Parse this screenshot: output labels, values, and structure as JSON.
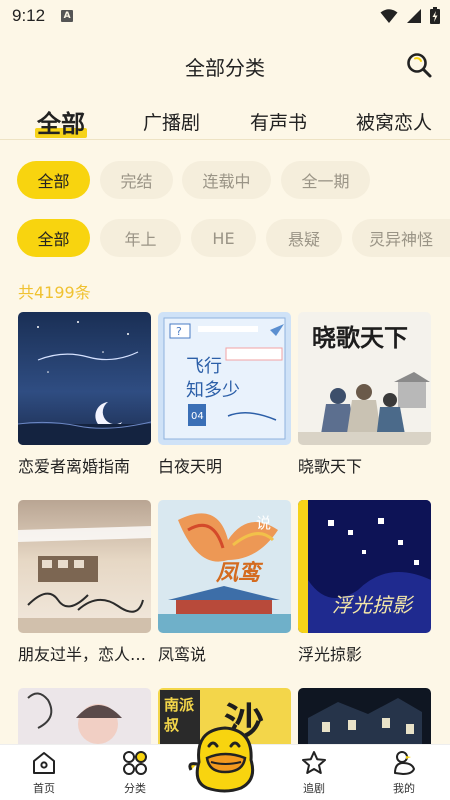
{
  "status": {
    "time": "9:12",
    "notification_glyph": "A"
  },
  "header": {
    "title": "全部分类",
    "search_icon": "search-icon"
  },
  "tabs": [
    {
      "label": "全部",
      "active": true
    },
    {
      "label": "广播剧",
      "active": false
    },
    {
      "label": "有声书",
      "active": false
    },
    {
      "label": "被窝恋人",
      "active": false
    }
  ],
  "filter_status": [
    {
      "label": "全部",
      "active": true
    },
    {
      "label": "完结",
      "active": false
    },
    {
      "label": "连载中",
      "active": false
    },
    {
      "label": "全一期",
      "active": false
    }
  ],
  "filter_genre": [
    {
      "label": "全部",
      "active": true
    },
    {
      "label": "年上",
      "active": false
    },
    {
      "label": "HE",
      "active": false
    },
    {
      "label": "悬疑",
      "active": false
    },
    {
      "label": "灵异神怪",
      "active": false
    }
  ],
  "result_count": "共4199条",
  "books": [
    {
      "title": "恋爱者离婚指南",
      "cover_text": ""
    },
    {
      "title": "白夜天明",
      "cover_text": "飞行知多少"
    },
    {
      "title": "晓歌天下",
      "cover_text": "晓歌天下"
    },
    {
      "title": "朋友过半，恋人未满",
      "cover_text": ""
    },
    {
      "title": "凤鸾说",
      "cover_text": "凤鸾说"
    },
    {
      "title": "浮光掠影",
      "cover_text": "浮光掠影"
    },
    {
      "title": "",
      "cover_text": ""
    },
    {
      "title": "",
      "cover_text": "南派叔"
    },
    {
      "title": "",
      "cover_text": ""
    }
  ],
  "bottom_nav": [
    {
      "label": "首页",
      "icon": "home-icon"
    },
    {
      "label": "分类",
      "icon": "category-icon"
    },
    {
      "label": "追剧",
      "icon": "star-icon"
    },
    {
      "label": "我的",
      "icon": "profile-duck-icon"
    }
  ],
  "colors": {
    "accent": "#f8d40f",
    "background": "#fdf7e7",
    "count_text": "#f0c232",
    "chip_bg": "#f5eedc"
  }
}
